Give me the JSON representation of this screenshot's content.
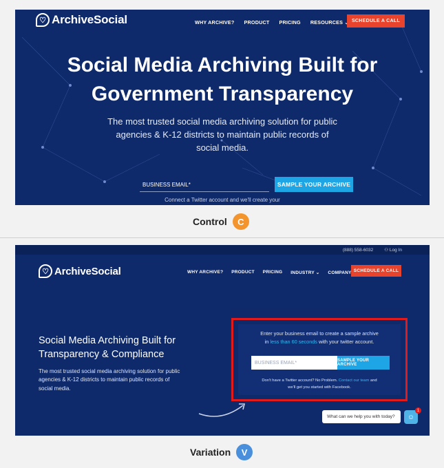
{
  "control": {
    "logo": "ArchiveSocial",
    "nav": [
      "WHY ARCHIVE?",
      "PRODUCT",
      "PRICING",
      "RESOURCES ⌄"
    ],
    "cta": "SCHEDULE A CALL",
    "title_line1": "Social Media Archiving Built for",
    "title_line2": "Government Transparency",
    "sub_line1": "The most trusted social media archiving solution for public",
    "sub_line2": "agencies & K-12 districts to maintain public records of",
    "sub_line3": "social media.",
    "email_placeholder": "BUSINESS EMAIL*",
    "sample_button": "SAMPLE YOUR ARCHIVE",
    "footnote": "Connect a Twitter account and we'll create your"
  },
  "control_caption": {
    "label": "Control",
    "badge": "C",
    "color": "#f3952c"
  },
  "variation": {
    "phone": "(888) 558-6032",
    "login": "Log In",
    "logo": "ArchiveSocial",
    "nav": [
      "WHY ARCHIVE?",
      "PRODUCT",
      "PRICING",
      "INDUSTRY ⌄",
      "COMPANY ⌄"
    ],
    "cta": "SCHEDULE A CALL",
    "title_line1": "Social Media Archiving Built for",
    "title_line2": "Transparency & Compliance",
    "sub_line1": "The most trusted social media archiving solution for public",
    "sub_line2": "agencies & K-12 districts to maintain public records of",
    "sub_line3": "social media.",
    "form_line1": "Enter your business email to create a sample archive",
    "form_line2_a": "in",
    "form_line2_hl": "less than 60 seconds",
    "form_line2_b": "with your twitter account.",
    "email_placeholder": "BUSINESS EMAIL*",
    "sample_button": "SAMPLE YOUR ARCHIVE",
    "note1_a": "Don't have a Twitter account? No Problem.",
    "note1_link": "Contact our team",
    "note1_b": "and",
    "note2": "we'll get you started with Facebook.",
    "chat": "What can we help you with today?",
    "chat_count": "1"
  },
  "variation_caption": {
    "label": "Variation",
    "badge": "V",
    "color": "#4a8fdc"
  }
}
